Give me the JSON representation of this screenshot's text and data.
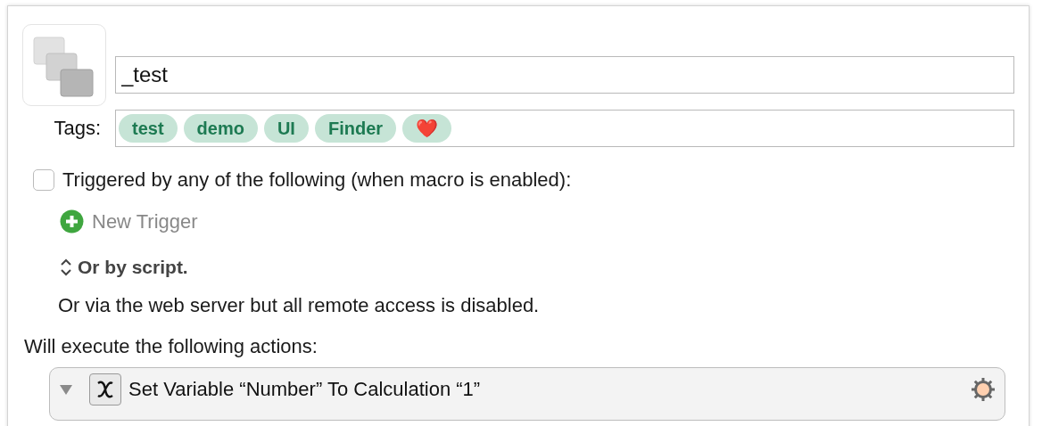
{
  "macro": {
    "name": "_test"
  },
  "tags": {
    "label": "Tags:",
    "items": [
      {
        "label": "test"
      },
      {
        "label": "demo"
      },
      {
        "label": "UI"
      },
      {
        "label": "Finder"
      },
      {
        "label": "❤️"
      }
    ]
  },
  "trigger": {
    "checked": false,
    "label": "Triggered by any of the following (when macro is enabled):"
  },
  "new_trigger": {
    "label": "New Trigger"
  },
  "script": {
    "label": "Or by script.",
    "expanded": false
  },
  "web_server_note": "Or via the web server but all remote access is disabled.",
  "actions_heading": "Will execute the following actions:",
  "actions": [
    {
      "title": "Set Variable “Number” To Calculation “1”",
      "expanded": true
    }
  ]
}
